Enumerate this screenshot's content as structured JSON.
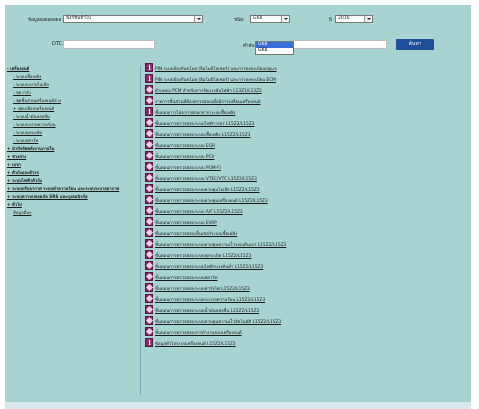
{
  "filters": {
    "model_label": "ข้อมูลผลผลผลผล",
    "model_value": "ฟังก์ชันทั่วไป",
    "type_label": "ชนิด:",
    "type_value": "GK8",
    "type_options": [
      "GK8",
      "GK8"
    ],
    "year_label": "ปี",
    "year_value": "2016",
    "dtc_label": "DTC",
    "dtc_placeholder": "",
    "search_label": "คำค้นหา",
    "search_placeholder": "",
    "submit_label": "ค้นหา"
  },
  "sidebar": [
    {
      "label": "- เครื่องยนต์",
      "level": "h"
    },
    {
      "label": "- ระบบเชื้อเพลิง",
      "level": "s"
    },
    {
      "label": "- ระบบระบายไอเสีย",
      "level": "s"
    },
    {
      "label": "- ชุดวาล์ว",
      "level": "s"
    },
    {
      "label": "- ชุดชิ้นส่วนเครื่องยนต์ล่าง",
      "level": "s"
    },
    {
      "label": "+ ชุดเปลือกเครื่องยนต์",
      "level": "s"
    },
    {
      "label": "- ระบบน้ำมันหล่อลื่น",
      "level": "s"
    },
    {
      "label": "- ระบบระบายความร้อน",
      "level": "s"
    },
    {
      "label": "- ระบบจุดระเบิด",
      "level": "s"
    },
    {
      "label": "- ระบบสตาร์ท",
      "level": "s"
    },
    {
      "label": "+ นำปัจจัยพลังงานภายใน",
      "level": "h"
    },
    {
      "label": "+ ช่วงล่าง",
      "level": "h"
    },
    {
      "label": "+ เบรก",
      "level": "h"
    },
    {
      "label": "+ ตัวถังและตัวรถ",
      "level": "h"
    },
    {
      "label": "+ ระบบไฟฟ้าตัวถัง",
      "level": "h"
    },
    {
      "label": "+ ระบบปรับอากาศ ระบบทำความร้อน และระบบระบายอากาศ",
      "level": "h"
    },
    {
      "label": "+ ระบบความปลอดภัย SRS และถุงลมนิรภัย",
      "level": "h"
    },
    {
      "label": "+ ทั่วไป",
      "level": "h"
    },
    {
      "label": "ข้อมูลอื่นๆ",
      "level": "h"
    }
  ],
  "content_rows": [
    {
      "icon": "info",
      "text": "PIN ระบบป้องกันขโมย (อิมโมบิไลเซอร์) และการลงทะเบียนกุญแจ"
    },
    {
      "icon": "info",
      "text": "PIN ระบบป้องกันขโมย (อิมโมบิไลเซอร์) และการลงทะเบียน ECM"
    },
    {
      "icon": "tool",
      "text": "ตำแหน่ง PCM สำหรับการวัดแรงดันไฟฟ้า L13Z1/L13Z2"
    },
    {
      "icon": "tool",
      "text": "รายการชิ้นส่วนที่ต้องตรวจสอบเมื่อมีการเปลี่ยนเครื่องยนต์"
    },
    {
      "icon": "info",
      "text": "ขั้นตอนการไล่อากาศออกจากระบบเชื้อเพลิง"
    },
    {
      "icon": "tool",
      "text": "ขั้นตอนการตรวจสอบระบบไฟฟ้าวงจร L15Z2/L15Z3"
    },
    {
      "icon": "tool",
      "text": "ขั้นตอนการตรวจสอบระบบเชื้อเพลิง L15Z2/L15Z3"
    },
    {
      "icon": "tool",
      "text": "ขั้นตอนการตรวจสอบระบบ EGR"
    },
    {
      "icon": "tool",
      "text": "ขั้นตอนการตรวจสอบระบบ PCV"
    },
    {
      "icon": "tool",
      "text": "ขั้นตอนการตรวจสอบระบบ PGM-FI"
    },
    {
      "icon": "tool",
      "text": "ขั้นตอนการตรวจสอบระบบ VTEC/VTC L15Z2/L15Z3"
    },
    {
      "icon": "tool",
      "text": "ขั้นตอนการตรวจสอบระบบควบคุมไอเสีย L15Z2/L15Z3"
    },
    {
      "icon": "tool",
      "text": "ขั้นตอนการตรวจสอบระบบควบคุมเครื่องยนต์ L15Z2/L15Z3"
    },
    {
      "icon": "tool",
      "text": "ขั้นตอนการตรวจสอบระบบ A/F L15Z2/L15Z3"
    },
    {
      "icon": "tool",
      "text": "ขั้นตอนการตรวจสอบระบบ EVAP"
    },
    {
      "icon": "tool",
      "text": "ขั้นตอนการตรวจสอบเซ็นเซอร์ระบบเชื้อเพลิง"
    },
    {
      "icon": "tool",
      "text": "ขั้นตอนการตรวจสอบระบบควบคุมความเร็วรอบเดินเบา L15Z2/L15Z3"
    },
    {
      "icon": "tool",
      "text": "ขั้นตอนการตรวจสอบระบบจุดระเบิด L15Z2/L15Z3"
    },
    {
      "icon": "tool",
      "text": "ขั้นตอนการตรวจสอบระบบไฟฟ้าแรงดันต่ำ L15Z2/L15Z3"
    },
    {
      "icon": "tool",
      "text": "ขั้นตอนการตรวจสอบระบบสตาร์ท"
    },
    {
      "icon": "tool",
      "text": "ขั้นตอนการตรวจสอบระบบชาร์จไฟ L15Z2/L15Z3"
    },
    {
      "icon": "tool",
      "text": "ขั้นตอนการตรวจสอบระบบระบายความร้อน L15Z2/L15Z3"
    },
    {
      "icon": "tool",
      "text": "ขั้นตอนการตรวจสอบระบบน้ำมันหล่อลื่น L15Z2/L15Z3"
    },
    {
      "icon": "tool",
      "text": "ขั้นตอนการตรวจสอบระบบควบคุมความเร็วอัตโนมัติ L15Z2/L15Z3"
    },
    {
      "icon": "tool",
      "text": "ขั้นตอนการตรวจสอบการทำงานของเครื่องยนต์"
    },
    {
      "icon": "info",
      "text": "ข้อมูลทั่วไประบบเครื่องยนต์ L15Z2/L15Z3"
    }
  ],
  "colors": {
    "bg": "#a7d3d1",
    "icon": "#8c2464",
    "button": "#1f4f9a"
  }
}
